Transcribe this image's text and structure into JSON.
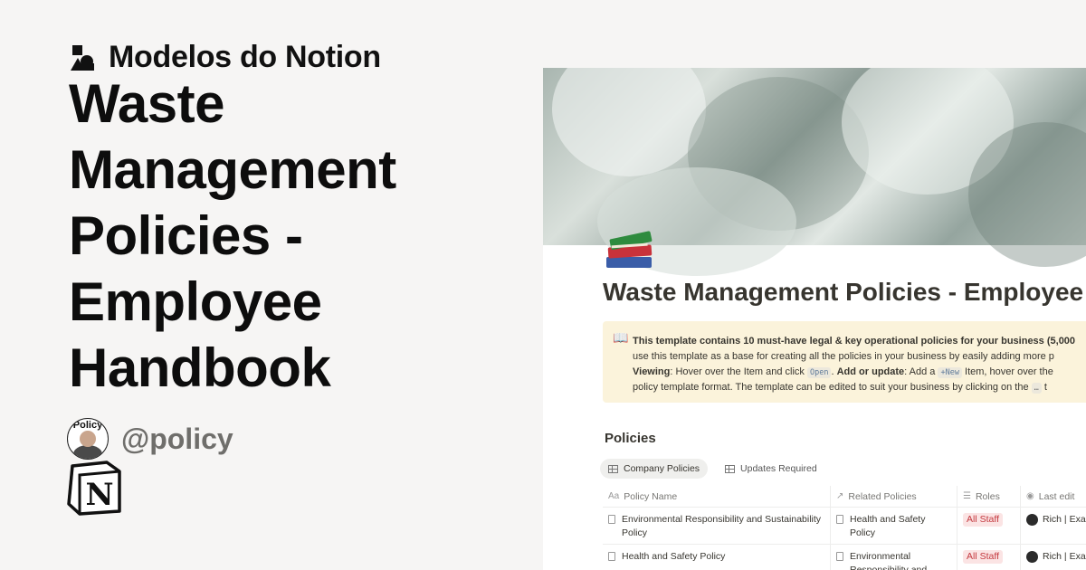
{
  "brand": {
    "name": "Modelos do Notion",
    "logo_icon": "notion-shapes-icon"
  },
  "title": "Waste Management Policies - Employee Handbook",
  "author": {
    "avatar_caption": "Policy",
    "handle": "@policy"
  },
  "notion_logo": {
    "letter": "N"
  },
  "preview": {
    "page_title": "Waste Management Policies - Employee Handbook",
    "callout": {
      "icon": "📖",
      "line1": "This template contains 10 must-have legal & key operational policies for your business (5,000",
      "line2": "use this template as a base for creating all the policies in your business by easily adding more p",
      "line3_label": "Viewing",
      "line3_text1": ": Hover over the Item and click ",
      "line3_code": "Open",
      "line3_text2": ". ",
      "line3_label2": "Add or update",
      "line3_text3": ": Add a ",
      "line3_code2": "+New",
      "line3_text4": " Item, hover over the",
      "line4_text": "policy template format. The template can be edited to suit your business by clicking on the ",
      "line4_code": "…",
      "line4_tail": " t"
    },
    "section_title": "Policies",
    "tabs": [
      {
        "label": "Company Policies",
        "active": true
      },
      {
        "label": "Updates Required",
        "active": false
      }
    ],
    "columns": [
      {
        "icon": "Aa",
        "label": "Policy Name"
      },
      {
        "icon": "↗",
        "label": "Related Policies"
      },
      {
        "icon": "☰",
        "label": "Roles"
      },
      {
        "icon": "◉",
        "label": "Last edit"
      }
    ],
    "rows": [
      {
        "name": "Environmental Responsibility and Sustainability Policy",
        "related": "Health and Safety Policy",
        "role": "All Staff",
        "last_edit": "Rich | Exar"
      },
      {
        "name": "Health and Safety Policy",
        "related": "Environmental Responsibility and",
        "role": "All Staff",
        "last_edit": "Rich | Exar"
      }
    ],
    "colors": {
      "tag_bg": "#fbe4e4",
      "tag_text": "#c4393f",
      "callout_bg": "#fbf3db"
    }
  }
}
